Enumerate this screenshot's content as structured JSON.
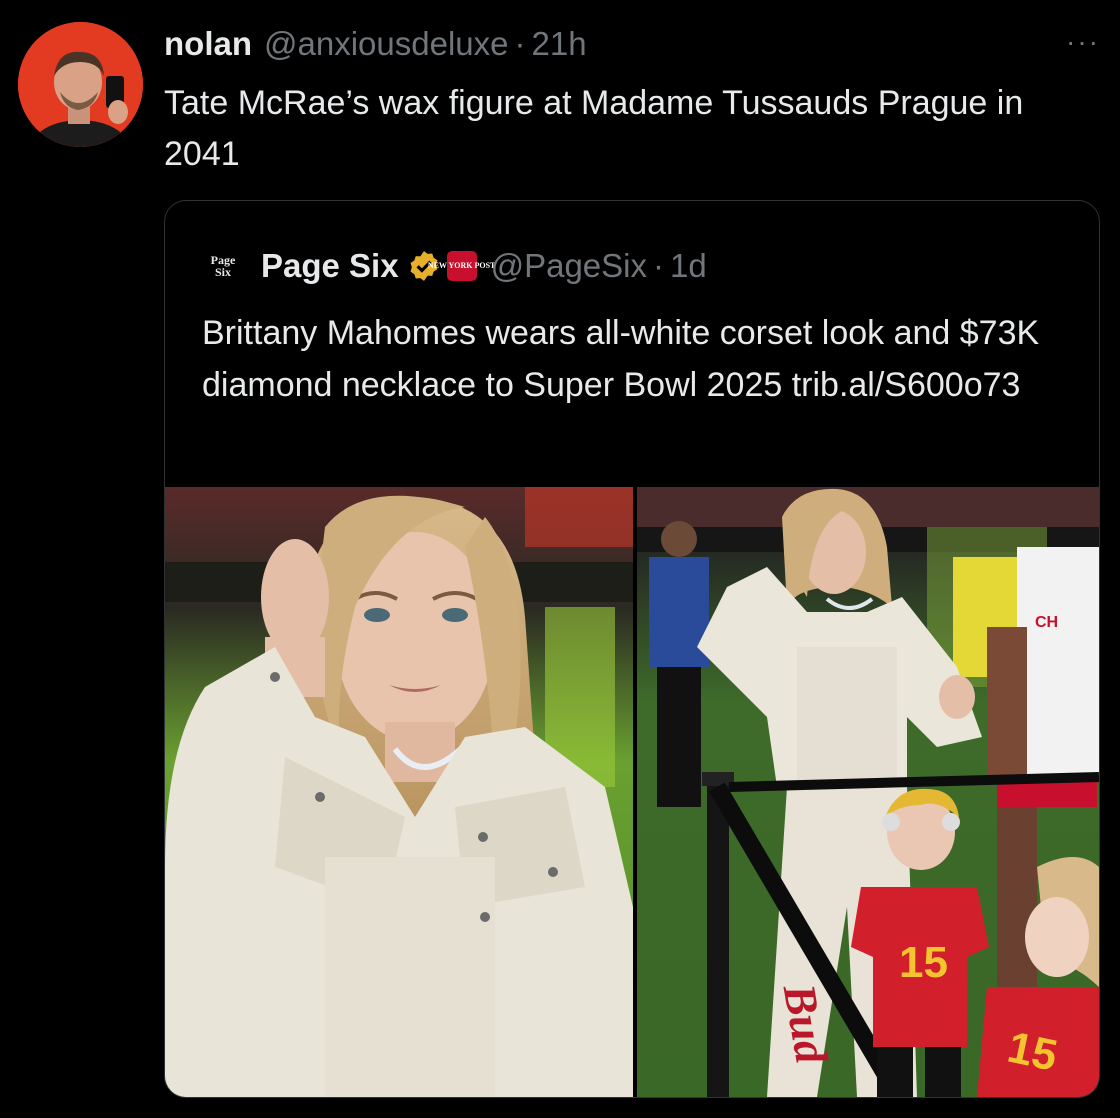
{
  "tweet": {
    "author_name": "nolan",
    "author_handle": "@anxiousdeluxe",
    "separator": "·",
    "time": "21h",
    "more_label": "···",
    "text": "Tate McRae’s wax figure at Madame Tussauds Prague in 2041"
  },
  "quoted": {
    "logo_text_top": "Page",
    "logo_text_bottom": "Six",
    "author_name": "Page Six",
    "badge_text": "NEW YORK POST",
    "author_handle": "@PageSix",
    "separator": "·",
    "time": "1d",
    "text": "Brittany Mahomes wears all-white corset look and $73K diamond necklace to Super Bowl 2025 ",
    "link": "trib.al/S600o73",
    "photos": [
      {
        "description_icon": "photo-woman-white-jacket"
      },
      {
        "description_icon": "photo-woman-with-children",
        "jersey_number": "15",
        "sleeve_text": "CH",
        "rope_text": "Bud"
      }
    ]
  },
  "colors": {
    "background": "#000000",
    "text": "#e7e9ea",
    "secondary": "#71767b",
    "border": "#2f3336",
    "verified": "#e8b02a",
    "avatar_bg": "#e33a22"
  }
}
